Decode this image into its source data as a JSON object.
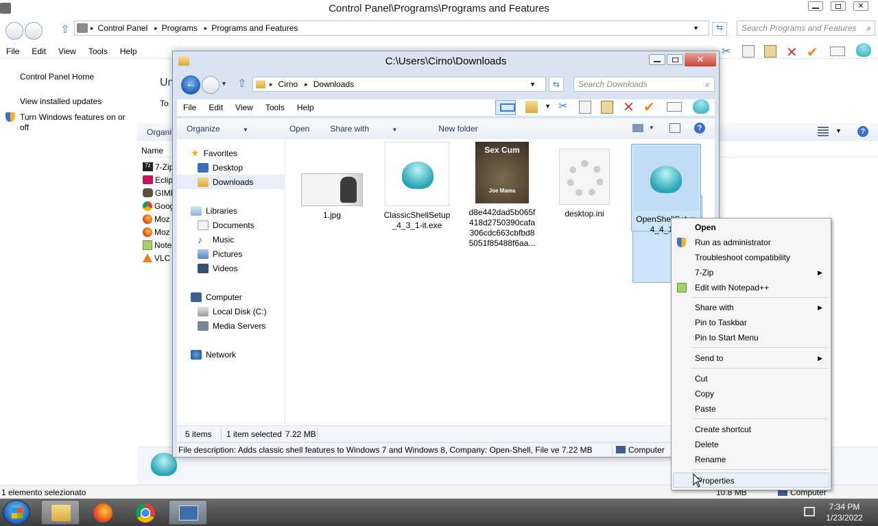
{
  "back_window": {
    "title": "Control Panel\\Programs\\Programs and Features",
    "breadcrumb": [
      "Control Panel",
      "Programs",
      "Programs and Features"
    ],
    "search_placeholder": "Search Programs and Features",
    "menu": [
      "File",
      "Edit",
      "View",
      "Tools",
      "Help"
    ],
    "sidebar": {
      "home": "Control Panel Home",
      "installed_updates": "View installed updates",
      "features": "Turn Windows features on or off"
    },
    "main": {
      "heading_partial": "Un",
      "subtext_partial": "To",
      "organize_partial": "Organi",
      "name_header": "Name",
      "programs": [
        "7-Zip",
        "Eclip",
        "GIMP",
        "Goog",
        "Moz",
        "Moz",
        "Note",
        "VLC"
      ]
    },
    "status_left": "1 elemento selezionato",
    "status_size": "10.8 MB",
    "status_computer": "Computer"
  },
  "front_window": {
    "title": "C:\\Users\\Cirno\\Downloads",
    "breadcrumb": [
      "Cirno",
      "Downloads"
    ],
    "search_placeholder": "Search Downloads",
    "menu": [
      "File",
      "Edit",
      "View",
      "Tools",
      "Help"
    ],
    "commands": {
      "organize": "Organize",
      "open": "Open",
      "share": "Share with",
      "new_folder": "New folder"
    },
    "nav": {
      "favorites": "Favorites",
      "desktop": "Desktop",
      "downloads": "Downloads",
      "libraries": "Libraries",
      "documents": "Documents",
      "music": "Music",
      "pictures": "Pictures",
      "videos": "Videos",
      "computer": "Computer",
      "local_disk": "Local Disk (C:)",
      "media_servers": "Media Servers",
      "network": "Network"
    },
    "files": [
      {
        "name": "1.jpg"
      },
      {
        "name": "ClassicShellSetup_4_3_1-it.exe",
        "line1": "ClassicShellSetup",
        "line2": "_4_3_1-it.exe"
      },
      {
        "line1": "d8e442dad5b065f",
        "line2": "418d2750390cafa",
        "line3": "306cdc663cbfbd8",
        "line4": "5051f85488f6aa...",
        "thumb_top": "Sex Cum",
        "thumb_bottom": "Joe Mama"
      },
      {
        "name": "desktop.ini"
      },
      {
        "line1": "OpenShellSetup",
        "line2": "4_4_160"
      }
    ],
    "details": {
      "count": "5 items",
      "selected": "1 item selected",
      "size": "7.22 MB"
    },
    "description": "File description: Adds classic shell features to Windows 7 and Windows 8, Company: Open-Shell, File ve 7.22 MB",
    "description_location": "Computer"
  },
  "context_menu": {
    "open": "Open",
    "run_admin": "Run as administrator",
    "troubleshoot": "Troubleshoot compatibility",
    "seven_zip": "7-Zip",
    "notepad": "Edit with Notepad++",
    "share_with": "Share with",
    "pin_taskbar": "Pin to Taskbar",
    "pin_start": "Pin to Start Menu",
    "send_to": "Send to",
    "cut": "Cut",
    "copy": "Copy",
    "paste": "Paste",
    "create_shortcut": "Create shortcut",
    "delete": "Delete",
    "rename": "Rename",
    "properties": "Properties"
  },
  "taskbar": {
    "time": "7:34 PM",
    "date": "1/23/2022",
    "apps": [
      "windows-explorer-icon",
      "firefox-icon",
      "chrome-icon",
      "control-panel-icon"
    ]
  },
  "colors": {
    "accent": "#3d7bd3",
    "close_red": "#c7463a",
    "taskbar": "#4a4a4a"
  }
}
